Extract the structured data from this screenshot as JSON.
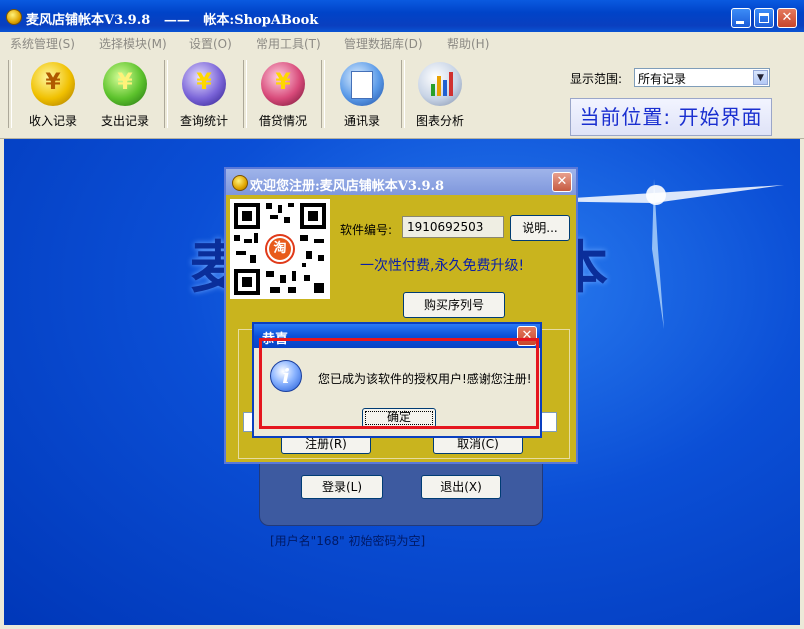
{
  "window": {
    "title": "麦风店铺帐本V3.9.8   ——   帐本:ShopABook"
  },
  "menu": [
    "系统管理(S)",
    "选择模块(M)",
    "设置(O)",
    "常用工具(T)",
    "管理数据库(D)",
    "帮助(H)"
  ],
  "toolbar": {
    "buttons": [
      {
        "label": "收入记录",
        "icon": "income-yen-icon"
      },
      {
        "label": "支出记录",
        "icon": "expense-yen-icon"
      },
      {
        "label": "查询统计",
        "icon": "search-stats-icon"
      },
      {
        "label": "借贷情况",
        "icon": "loan-icon"
      },
      {
        "label": "通讯录",
        "icon": "contacts-icon"
      },
      {
        "label": "图表分析",
        "icon": "chart-icon"
      }
    ],
    "range_label": "显示范围:",
    "range_value": "所有记录",
    "location": "当前位置: 开始界面"
  },
  "workspace": {
    "bg_left": "麦",
    "bg_right": "本",
    "login_button": "登录(L)",
    "exit_button": "退出(X)",
    "hint": "[用户名\"168\" 初始密码为空]"
  },
  "register_dialog": {
    "title": "欢迎您注册:麦风店铺帐本V3.9.8",
    "software_no_label": "软件编号:",
    "software_no": "1910692503",
    "explain_button": "说明...",
    "slogan": "一次性付费,永久免费升级!",
    "buy_button": "购买序列号",
    "register_button": "注册(R)",
    "cancel_button": "取消(C)",
    "qr_badge": "淘"
  },
  "message_dialog": {
    "title": "恭喜",
    "text": "您已成为该软件的授权用户!感谢您注册!",
    "ok_button": "确定"
  },
  "colors": {
    "titlebar": "#0a4fd0",
    "workspace": "#0b4fd6",
    "register_bg": "#c9b41e",
    "highlight": "#e5161e"
  }
}
